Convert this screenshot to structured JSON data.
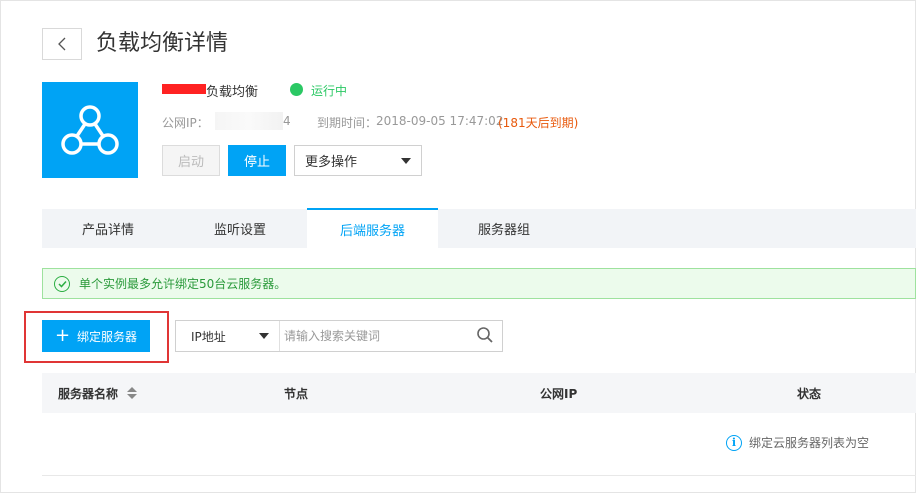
{
  "header": {
    "title": "负载均衡详情"
  },
  "instance": {
    "name_suffix": "负载均衡",
    "status": "运行中",
    "ip_label": "公网IP：",
    "ip_tail": "4",
    "expire_label": "到期时间：",
    "expire_value": "2018-09-05 17:47:02",
    "expire_note": "(181天后到期)"
  },
  "actions": {
    "start": "启动",
    "stop": "停止",
    "more": "更多操作"
  },
  "tabs": [
    {
      "label": "产品详情"
    },
    {
      "label": "监听设置"
    },
    {
      "label": "后端服务器"
    },
    {
      "label": "服务器组"
    }
  ],
  "notice": {
    "text": "单个实例最多允许绑定50台云服务器。"
  },
  "toolbar": {
    "bind_label": "绑定服务器",
    "search_field": "IP地址",
    "search_placeholder": "请输入搜索关键词"
  },
  "table": {
    "columns": [
      "服务器名称",
      "节点",
      "公网IP",
      "状态"
    ],
    "empty_text": "绑定云服务器列表为空"
  },
  "colors": {
    "primary": "#00a3f5",
    "success": "#2bc864",
    "warning": "#e8590c",
    "highlight_border": "#e03535"
  }
}
